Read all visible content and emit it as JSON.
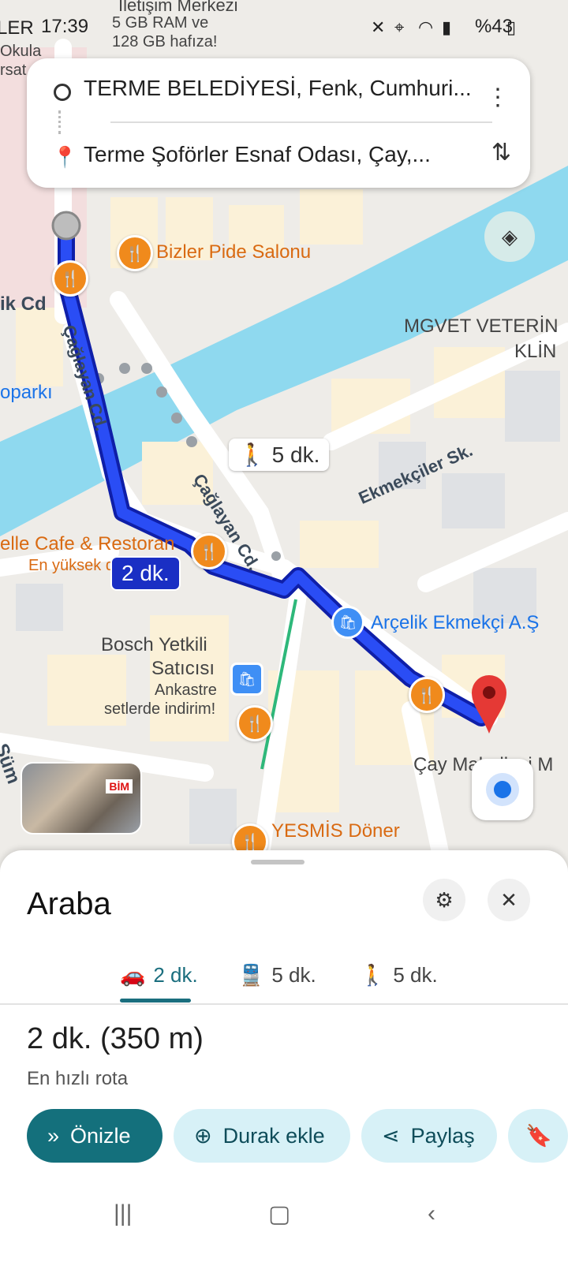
{
  "status_bar": {
    "prefix": "LER",
    "time": "17:39",
    "battery": "%43",
    "icons": [
      "mute-icon",
      "location-icon",
      "wifi-icon",
      "signal-icon",
      "battery-icon"
    ]
  },
  "search": {
    "origin": "TERME BELEDİYESİ, Fenk, Cumhuri...",
    "destination": "Terme Şoförler Esnaf Odası, Çay,...",
    "menu_icon": "more-vert-icon",
    "swap_icon": "swap-vert-icon"
  },
  "map": {
    "labels": {
      "iletisim_1": "İletişim Merkezi",
      "iletisim_2": "5 GB RAM ve",
      "iletisim_3": "128 GB hafıza!",
      "okula": "Okula",
      "rsat": "rsat",
      "bizler": "Bizler Pide Salonu",
      "ik_cd": "ik Cd",
      "mgvet_1": "MGVET VETERİN",
      "mgvet_2": "KLİN",
      "oparki": "oparkı",
      "ekmekciler": "Ekmekçiler Sk.",
      "caglayan_1": "Çağlayan Cd.",
      "caglayan_2": "Çağlayan Cd.",
      "elle_cafe": "elle Cafe & Restoran",
      "en_yuksek": "En yüksek d",
      "arcelik": "Arçelik Ekmekçi A.Ş",
      "bosch_1": "Bosch Yetkili",
      "bosch_2": "Satıcısı",
      "bosch_3": "Ankastre",
      "bosch_4": "setlerde indirim!",
      "cay_mah": "Çay Mahallesi M",
      "sum": "Süm",
      "yesmis": "YESMİS Döner"
    },
    "walk_chip": "5 dk.",
    "drive_chip": "2 dk.",
    "thumbnail_sign": "BİM",
    "layers_icon": "layers-icon",
    "locate_icon": "my-location-icon"
  },
  "sheet": {
    "title": "Araba",
    "options_icon": "tune-icon",
    "close_icon": "close-icon",
    "tabs": [
      {
        "icon": "car-icon",
        "label": "2 dk.",
        "active": true
      },
      {
        "icon": "transit-icon",
        "label": "5 dk."
      },
      {
        "icon": "walk-icon",
        "label": "5 dk."
      }
    ],
    "route_time": "2 dk.",
    "route_distance": "(350 m)",
    "route_note": "En hızlı rota",
    "actions": {
      "preview": "Önizle",
      "add_stop": "Durak ekle",
      "share": "Paylaş"
    }
  },
  "colors": {
    "route": "#1a2fc4",
    "water": "#8fd9ef",
    "accent": "#14707c",
    "poi_food": "#f08a1c"
  }
}
